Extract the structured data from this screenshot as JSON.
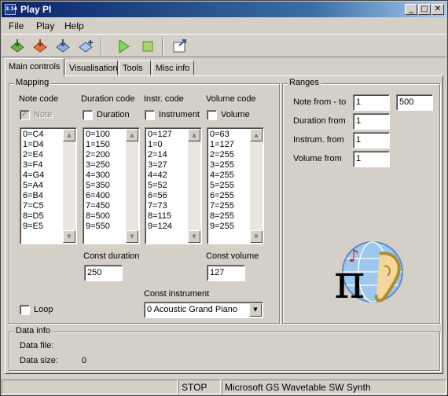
{
  "window": {
    "title": "Play PI",
    "icon_label": "3.14",
    "controls": {
      "minimize": "_",
      "maximize": "□",
      "close": "✕"
    }
  },
  "menu": {
    "file": "File",
    "play": "Play",
    "help": "Help"
  },
  "toolbar": {
    "icons": [
      "open-green-icon",
      "open-orange-icon",
      "open-blue-icon",
      "add-blue-icon",
      "play-icon",
      "stop-icon",
      "export-icon"
    ]
  },
  "tabs": [
    "Main controls",
    "Visualisation",
    "Tools",
    "Misc info"
  ],
  "mapping": {
    "title": "Mapping",
    "note": {
      "header": "Note code",
      "check_label": "Note",
      "items": [
        "0=C4",
        "1=D4",
        "2=E4",
        "3=F4",
        "4=G4",
        "5=A4",
        "6=B4",
        "7=C5",
        "8=D5",
        "9=E5"
      ]
    },
    "duration": {
      "header": "Duration code",
      "check_label": "Duration",
      "items": [
        "0=100",
        "1=150",
        "2=200",
        "3=250",
        "4=300",
        "5=350",
        "6=400",
        "7=450",
        "8=500",
        "9=550"
      ]
    },
    "instrument": {
      "header": "Instr. code",
      "check_label": "Instrument",
      "items": [
        "0=127",
        "1=0",
        "2=14",
        "3=27",
        "4=42",
        "5=52",
        "6=56",
        "7=73",
        "8=115",
        "9=124"
      ]
    },
    "volume": {
      "header": "Volume code",
      "check_label": "Volume",
      "items": [
        "0=63",
        "1=127",
        "2=255",
        "3=255",
        "4=255",
        "5=255",
        "6=255",
        "7=255",
        "8=255",
        "9=255"
      ]
    },
    "const_duration_label": "Const duration",
    "const_duration_value": "250",
    "const_volume_label": "Const volume",
    "const_volume_value": "127",
    "const_instrument_label": "Const instrument",
    "const_instrument_value": "0 Acoustic Grand Piano",
    "loop_label": "Loop"
  },
  "ranges": {
    "title": "Ranges",
    "note_label": "Note from - to",
    "note_from": "1",
    "note_to": "500",
    "duration_label": "Duration from",
    "duration_from": "1",
    "instrum_label": "Instrum. from",
    "instrum_from": "1",
    "volume_label": "Volume from",
    "volume_from": "1"
  },
  "data_info": {
    "title": "Data info",
    "file_label": "Data file:",
    "file_value": "",
    "size_label": "Data size:",
    "size_value": "0"
  },
  "status": {
    "state": "STOP",
    "synth": "Microsoft GS Wavetable SW Synth"
  },
  "logo": {
    "pi": "π",
    "note": "♪"
  }
}
